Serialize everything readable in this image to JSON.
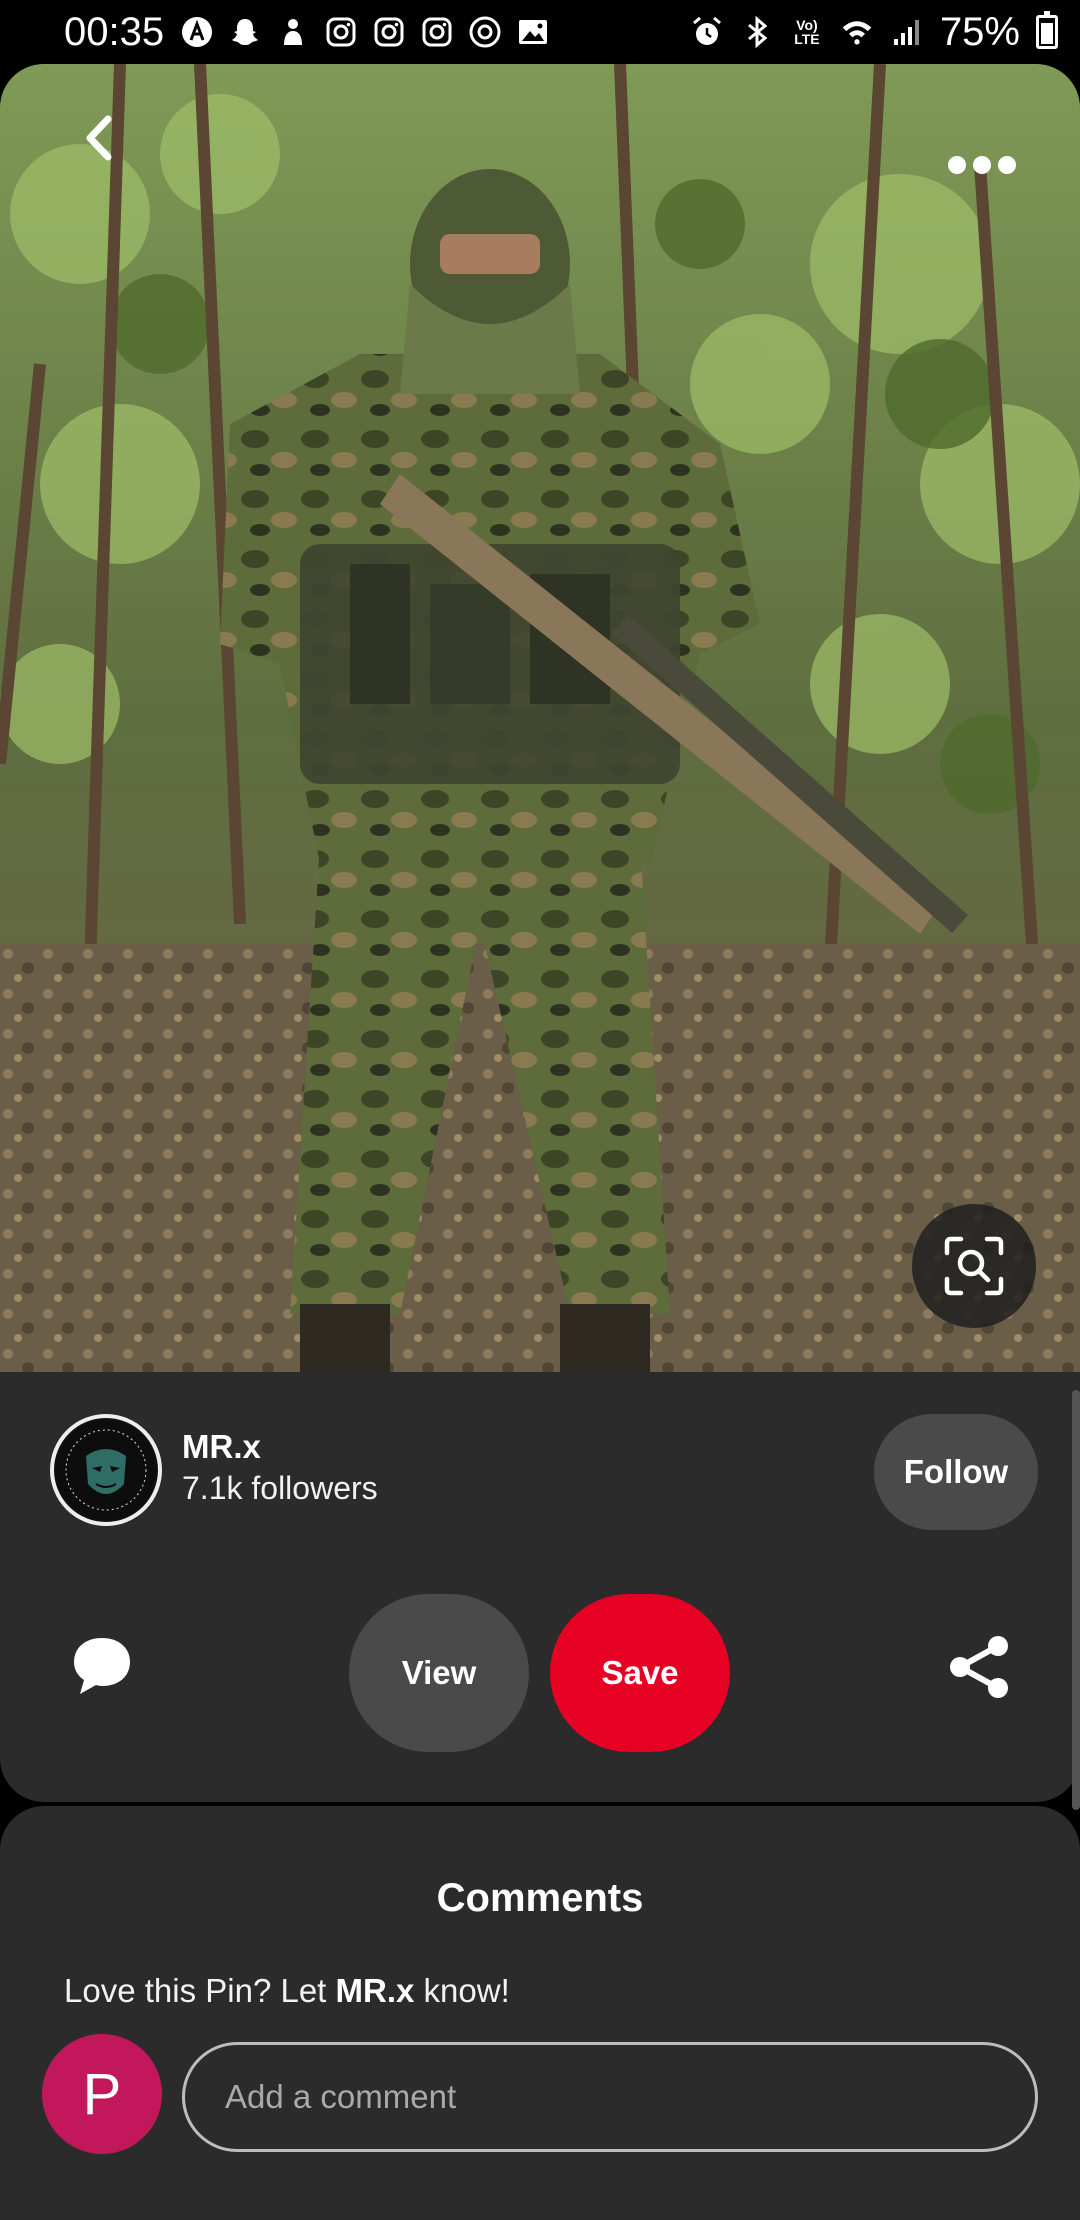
{
  "status_bar": {
    "time": "00:35",
    "battery_percent": "75%",
    "battery_level": 0.75,
    "network_label": "LTE",
    "left_icons": [
      "app-a-icon",
      "snapchat-icon",
      "notification-icon",
      "instagram-icon",
      "instagram-icon",
      "instagram-icon",
      "threads-icon",
      "gallery-icon"
    ],
    "right_icons": [
      "alarm-icon",
      "bluetooth-icon",
      "volte-icon",
      "wifi-icon",
      "signal-icon",
      "battery-icon"
    ]
  },
  "pin": {
    "image_description_icon": "lens-search-icon",
    "top_left_icon": "back-chevron-icon",
    "top_right_icon": "more-options-icon"
  },
  "creator": {
    "name": "MR.x",
    "followers": "7.1k followers",
    "avatar_text": "MR.X.DARKINIGHT",
    "follow_label": "Follow"
  },
  "actions": {
    "comment_icon": "comment-bubble-icon",
    "view_label": "View",
    "save_label": "Save",
    "share_icon": "share-icon"
  },
  "comments": {
    "title": "Comments",
    "prompt_prefix": "Love this Pin? Let",
    "prompt_name": "MR.x",
    "prompt_suffix": "know!",
    "user_initial": "P",
    "input_placeholder": "Add a comment"
  },
  "colors": {
    "save_red": "#e60023",
    "card_bg": "#2b2b2b",
    "button_gray": "#4a4a4a",
    "user_avatar": "#c2185b"
  }
}
